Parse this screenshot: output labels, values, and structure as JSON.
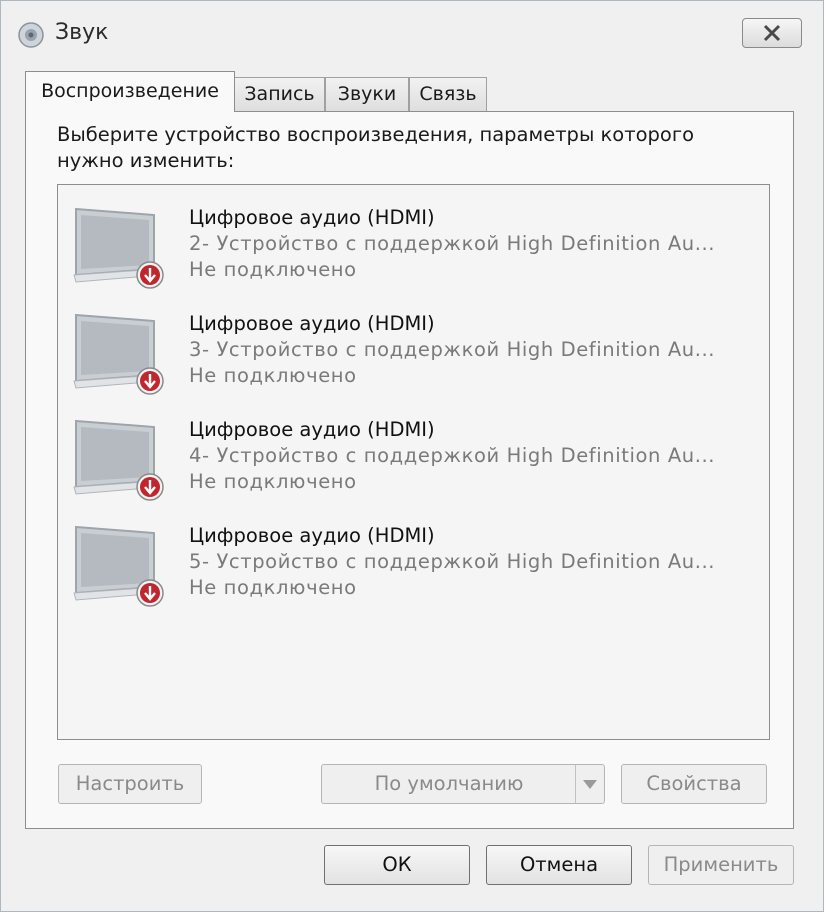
{
  "window": {
    "title": "Звук",
    "icon": "speaker-icon"
  },
  "tabs": [
    {
      "label": "Воспроизведение",
      "active": true
    },
    {
      "label": "Запись",
      "active": false
    },
    {
      "label": "Звуки",
      "active": false
    },
    {
      "label": "Связь",
      "active": false
    }
  ],
  "playback": {
    "instruction": "Выберите устройство воспроизведения, параметры которого нужно изменить:",
    "devices": [
      {
        "name": "Цифровое аудио (HDMI)",
        "description": "2- Устройство с поддержкой High Definition Au...",
        "status": "Не подключено",
        "icon": "monitor-disconnected-icon"
      },
      {
        "name": "Цифровое аудио (HDMI)",
        "description": "3- Устройство с поддержкой High Definition Au...",
        "status": "Не подключено",
        "icon": "monitor-disconnected-icon"
      },
      {
        "name": "Цифровое аудио (HDMI)",
        "description": "4- Устройство с поддержкой High Definition Au...",
        "status": "Не подключено",
        "icon": "monitor-disconnected-icon"
      },
      {
        "name": "Цифровое аудио (HDMI)",
        "description": "5- Устройство с поддержкой High Definition Au...",
        "status": "Не подключено",
        "icon": "monitor-disconnected-icon"
      }
    ],
    "configure_label": "Настроить",
    "default_label": "По умолчанию",
    "properties_label": "Свойства"
  },
  "footer": {
    "ok_label": "ОК",
    "cancel_label": "Отмена",
    "apply_label": "Применить"
  },
  "colors": {
    "error_badge": "#c0262d",
    "panel_border": "#8d8d8d"
  }
}
